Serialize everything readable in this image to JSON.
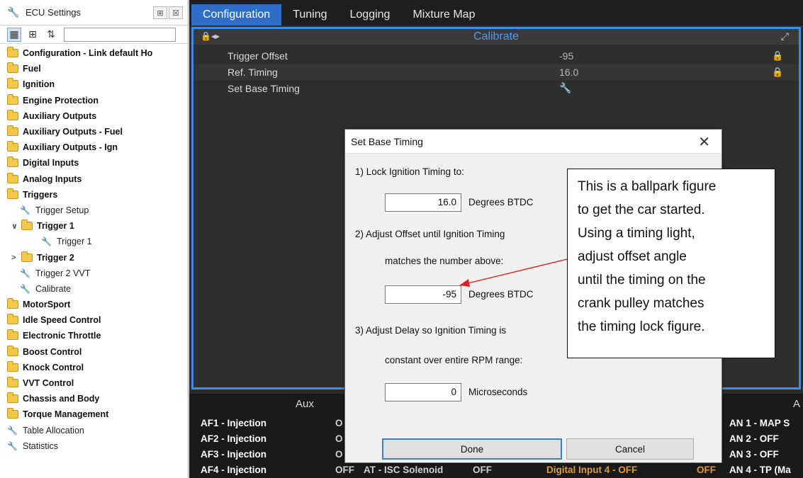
{
  "left_panel": {
    "title": "ECU Settings",
    "pin_button": "⊞",
    "close_button": "☒",
    "tree": [
      {
        "label": "Configuration - Link default Ho",
        "kind": "cat"
      },
      {
        "label": "Fuel",
        "kind": "cat"
      },
      {
        "label": "Ignition",
        "kind": "cat"
      },
      {
        "label": "Engine Protection",
        "kind": "cat"
      },
      {
        "label": "Auxiliary Outputs",
        "kind": "cat"
      },
      {
        "label": "Auxiliary Outputs - Fuel",
        "kind": "cat"
      },
      {
        "label": "Auxiliary Outputs - Ign",
        "kind": "cat"
      },
      {
        "label": "Digital Inputs",
        "kind": "cat"
      },
      {
        "label": "Analog Inputs",
        "kind": "cat"
      },
      {
        "label": "Triggers",
        "kind": "cat"
      },
      {
        "label": "Trigger Setup",
        "kind": "sub"
      },
      {
        "label": "Trigger 1",
        "kind": "cat2",
        "expander": "∨"
      },
      {
        "label": "Trigger 1",
        "kind": "sub2"
      },
      {
        "label": "Trigger 2",
        "kind": "cat2",
        "expander": ">"
      },
      {
        "label": "Trigger 2 VVT",
        "kind": "sub"
      },
      {
        "label": "Calibrate",
        "kind": "sub"
      },
      {
        "label": "MotorSport",
        "kind": "cat"
      },
      {
        "label": "Idle Speed Control",
        "kind": "cat"
      },
      {
        "label": "Electronic Throttle",
        "kind": "cat"
      },
      {
        "label": "Boost Control",
        "kind": "cat"
      },
      {
        "label": "Knock Control",
        "kind": "cat"
      },
      {
        "label": "VVT Control",
        "kind": "cat"
      },
      {
        "label": "Chassis and Body",
        "kind": "cat"
      },
      {
        "label": "Torque Management",
        "kind": "cat"
      },
      {
        "label": "Table Allocation",
        "kind": "tool"
      },
      {
        "label": "Statistics",
        "kind": "tool"
      }
    ]
  },
  "tabs": [
    "Configuration",
    "Tuning",
    "Logging",
    "Mixture Map"
  ],
  "active_tab": "Configuration",
  "calibrate": {
    "title": "Calibrate",
    "rows": [
      {
        "name": "Trigger Offset",
        "value": "-95",
        "locked": true
      },
      {
        "name": "Ref. Timing",
        "value": "16.0",
        "locked": true
      },
      {
        "name": "Set Base Timing",
        "value": "",
        "locked": false
      }
    ]
  },
  "aux": {
    "head_left": "Aux",
    "head_right": "A",
    "rows": [
      {
        "name": "AF1 - Injection",
        "state": "O",
        "an": "AN 1 - MAP S"
      },
      {
        "name": "AF2 - Injection",
        "state": "O",
        "an": "AN 2 - OFF"
      },
      {
        "name": "AF3 - Injection",
        "state": "O",
        "an": "AN 3 - OFF"
      },
      {
        "name": "AF4 - Injection",
        "state": "OFF",
        "mid": "AT - ISC Solenoid",
        "mid_state": "OFF",
        "digital": "Digital Input 4 - OFF",
        "digital_state": "OFF",
        "an": "AN 4 - TP (Ma"
      }
    ]
  },
  "dialog": {
    "title": "Set Base Timing",
    "close": "✕",
    "step1": "1) Lock Ignition Timing to:",
    "lock_value": "16.0",
    "lock_unit": "Degrees BTDC",
    "step2_a": "2) Adjust Offset until Ignition Timing",
    "step2_b": "matches the number above:",
    "offset_value": "-95",
    "offset_unit": "Degrees BTDC",
    "step3_a": "3) Adjust Delay so Ignition Timing is",
    "step3_b": "constant over entire RPM range:",
    "delay_value": "0",
    "delay_unit": "Microseconds",
    "done": "Done",
    "cancel": "Cancel"
  },
  "annotation": {
    "lines": [
      "This is a ballpark figure",
      "to get the car started.",
      "Using a timing light,",
      "adjust offset angle",
      "until the timing on the",
      "crank pulley matches",
      "the timing lock figure."
    ],
    "arrow_color": "#e02020"
  },
  "colors": {
    "accent": "#3e8cea",
    "active_tab": "#2f6ec8",
    "folder": "#f3c74a",
    "aux_orange": "#e49b2b"
  }
}
